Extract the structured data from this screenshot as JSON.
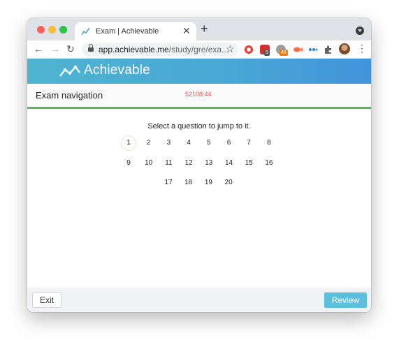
{
  "browser": {
    "tab": {
      "title": "Exam | Achievable",
      "favicon": "achievable-chart-icon"
    },
    "new_tab_symbol": "+",
    "tab_close_symbol": "✕",
    "back_symbol": "←",
    "forward_symbol": "→",
    "reload_symbol": "↻",
    "url_host": "app.achievable.me",
    "url_path": "/study/gre/exa...",
    "bookmark_symbol": "☆",
    "extensions": [
      {
        "name": "red-circle-extension-icon",
        "color": "#e53935"
      },
      {
        "name": "todo-extension-icon",
        "color": "#d32f2f",
        "badge": "5"
      },
      {
        "name": "gray-extension-icon",
        "color": "#9e9e9e",
        "badge": "40"
      },
      {
        "name": "fish-extension-icon",
        "color": "#ff7043"
      },
      {
        "name": "blue-dots-extension-icon",
        "color": "#1e88e5"
      },
      {
        "name": "puzzle-extension-icon",
        "color": "#5f6368"
      }
    ],
    "menu_symbol": "⋮"
  },
  "app": {
    "brand": "Achievable",
    "brand_color": "#49a6d6",
    "header_title": "Exam navigation",
    "timer": "52108:44",
    "instruction": "Select a question to jump to it.",
    "questions": [
      "1",
      "2",
      "3",
      "4",
      "5",
      "6",
      "7",
      "8",
      "9",
      "10",
      "11",
      "12",
      "13",
      "14",
      "15",
      "16",
      "17",
      "18",
      "19",
      "20"
    ],
    "current_question": "1",
    "exit_label": "Exit",
    "review_label": "Review",
    "accent_green": "#5cb85c",
    "review_color": "#5bc0de"
  }
}
